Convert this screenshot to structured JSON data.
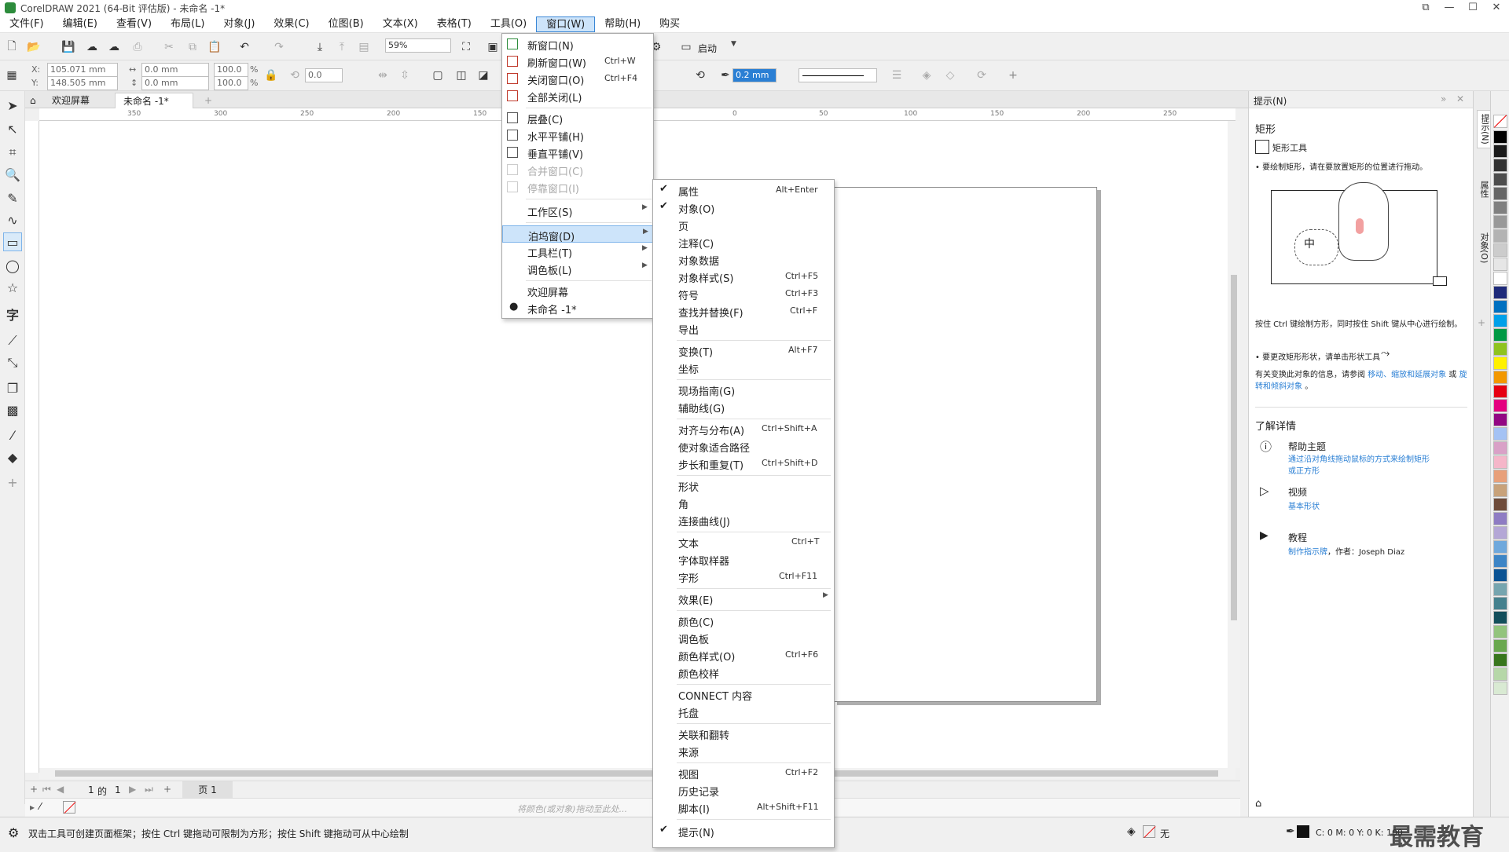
{
  "title_bar": {
    "title": "CorelDRAW 2021 (64-Bit 评估版) - 未命名 -1*"
  },
  "menu_bar": [
    "文件(F)",
    "编辑(E)",
    "查看(V)",
    "布局(L)",
    "对象(J)",
    "效果(C)",
    "位图(B)",
    "文本(X)",
    "表格(T)",
    "工具(O)",
    "窗口(W)",
    "帮助(H)",
    "购买"
  ],
  "toolbar_standard": {
    "zoom_value": "59%",
    "launch_label": "启动"
  },
  "property_bar": {
    "x_label": "X:",
    "x_value": "105.071 mm",
    "y_label": "Y:",
    "y_value": "148.505 mm",
    "w_value": "0.0 mm",
    "h_value": "0.0 mm",
    "scale_x": "100.0",
    "scale_y": "100.0",
    "percent": "%",
    "angle_value": "0.0",
    "outline_width": "0.2 mm"
  },
  "tabs": {
    "welcome": "欢迎屏幕",
    "document": "未命名 -1*"
  },
  "ruler_labels": [
    "350",
    "300",
    "250",
    "200",
    "150",
    "100",
    "50",
    "0",
    "50",
    "100",
    "150",
    "200",
    "250"
  ],
  "page_nav": {
    "current": "1",
    "of_label": "的",
    "total": "1",
    "page_tab": "页 1"
  },
  "color_bar_hint": "将颜色(或对象)拖动至此处...",
  "status_bar": {
    "hint": "双击工具可创建页面框架；按住 Ctrl 键拖动可限制为方形；按住 Shift 键拖动可从中心绘制",
    "fill_label": "无",
    "cmyk": "C: 0 M: 0 Y: 0 K: 100"
  },
  "watermark": "最需教育",
  "window_menu": [
    {
      "label": "新窗口(N)",
      "shortcut": ""
    },
    {
      "label": "刷新窗口(W)",
      "shortcut": "Ctrl+W"
    },
    {
      "label": "关闭窗口(O)",
      "shortcut": "Ctrl+F4"
    },
    {
      "label": "全部关闭(L)",
      "shortcut": ""
    },
    {
      "label": "层叠(C)",
      "shortcut": ""
    },
    {
      "label": "水平平铺(H)",
      "shortcut": ""
    },
    {
      "label": "垂直平铺(V)",
      "shortcut": ""
    },
    {
      "label": "合并窗口(C)",
      "shortcut": ""
    },
    {
      "label": "停靠窗口(I)",
      "shortcut": ""
    },
    {
      "label": "工作区(S)",
      "shortcut": ""
    },
    {
      "label": "泊坞窗(D)",
      "shortcut": ""
    },
    {
      "label": "工具栏(T)",
      "shortcut": ""
    },
    {
      "label": "调色板(L)",
      "shortcut": ""
    },
    {
      "label": "欢迎屏幕",
      "shortcut": ""
    },
    {
      "label": "未命名 -1*",
      "shortcut": ""
    }
  ],
  "docker_menu": [
    {
      "label": "属性",
      "shortcut": "Alt+Enter",
      "checked": true
    },
    {
      "label": "对象(O)",
      "shortcut": "",
      "checked": true
    },
    {
      "label": "页",
      "shortcut": ""
    },
    {
      "label": "注释(C)",
      "shortcut": ""
    },
    {
      "label": "对象数据",
      "shortcut": ""
    },
    {
      "label": "对象样式(S)",
      "shortcut": "Ctrl+F5"
    },
    {
      "label": "符号",
      "shortcut": "Ctrl+F3"
    },
    {
      "label": "查找并替换(F)",
      "shortcut": "Ctrl+F"
    },
    {
      "label": "导出",
      "shortcut": ""
    },
    {
      "label": "变换(T)",
      "shortcut": "Alt+F7"
    },
    {
      "label": "坐标",
      "shortcut": ""
    },
    {
      "label": "现场指南(G)",
      "shortcut": ""
    },
    {
      "label": "辅助线(G)",
      "shortcut": ""
    },
    {
      "label": "对齐与分布(A)",
      "shortcut": "Ctrl+Shift+A"
    },
    {
      "label": "使对象适合路径",
      "shortcut": ""
    },
    {
      "label": "步长和重复(T)",
      "shortcut": "Ctrl+Shift+D"
    },
    {
      "label": "形状",
      "shortcut": ""
    },
    {
      "label": "角",
      "shortcut": ""
    },
    {
      "label": "连接曲线(J)",
      "shortcut": ""
    },
    {
      "label": "文本",
      "shortcut": "Ctrl+T"
    },
    {
      "label": "字体取样器",
      "shortcut": ""
    },
    {
      "label": "字形",
      "shortcut": "Ctrl+F11"
    },
    {
      "label": "效果(E)",
      "shortcut": ""
    },
    {
      "label": "颜色(C)",
      "shortcut": ""
    },
    {
      "label": "调色板",
      "shortcut": ""
    },
    {
      "label": "颜色样式(O)",
      "shortcut": "Ctrl+F6"
    },
    {
      "label": "颜色校样",
      "shortcut": ""
    },
    {
      "label": "CONNECT 内容",
      "shortcut": ""
    },
    {
      "label": "托盘",
      "shortcut": ""
    },
    {
      "label": "关联和翻转",
      "shortcut": ""
    },
    {
      "label": "来源",
      "shortcut": ""
    },
    {
      "label": "视图",
      "shortcut": "Ctrl+F2"
    },
    {
      "label": "历史记录",
      "shortcut": ""
    },
    {
      "label": "脚本(I)",
      "shortcut": "Alt+Shift+F11"
    },
    {
      "label": "提示(N)",
      "shortcut": "",
      "checked": true
    }
  ],
  "hints_docker": {
    "title": "提示(N)",
    "section": "矩形",
    "tool_name": "矩形工具",
    "tip1": "• 要绘制矩形，请在要放置矩形的位置进行拖动。",
    "tip2": "按住 Ctrl 键绘制方形，同时按住 Shift 键从中心进行绘制。",
    "tip3": "• 要更改矩形形状，请单击形状工具",
    "more_info_prefix": "有关变换此对象的信息，请参阅",
    "more_info_link1": "移动、缩放和延展对象",
    "more_info_mid": "或",
    "more_info_link2": "旋转和倾斜对象",
    "more_info_end": "。",
    "learn_more": "了解详情",
    "help_title": "帮助主题",
    "help_link": "通过沿对角线拖动鼠标的方式来绘制矩形或正方形",
    "video_title": "视频",
    "video_link": "基本形状",
    "tutorial_title": "教程",
    "tutorial_link": "制作指示牌",
    "tutorial_author": "，作者：Joseph Diaz",
    "illustration_text": "中"
  },
  "docker_side_tabs": [
    "提示(N)",
    "属性",
    "对象(O)"
  ],
  "palette_colors": [
    "#000000",
    "#1a1a1a",
    "#333333",
    "#4d4d4d",
    "#666666",
    "#808080",
    "#999999",
    "#b3b3b3",
    "#cccccc",
    "#e6e6e6",
    "#ffffff",
    "#1e2a7a",
    "#0070c0",
    "#00a0e9",
    "#009944",
    "#8fc31f",
    "#fff100",
    "#f39800",
    "#e60012",
    "#e4007f",
    "#920783",
    "#a4c2f4",
    "#d9a1c7",
    "#f5b6c9",
    "#e8a07a",
    "#c8a27a",
    "#6e4b3a",
    "#8e7cc3",
    "#b4a7d6",
    "#6fa8dc",
    "#3d85c6",
    "#0b5394",
    "#76a5af",
    "#45818e",
    "#134f5c",
    "#93c47d",
    "#6aa84f",
    "#38761d",
    "#b6d7a8",
    "#d9ead3"
  ]
}
